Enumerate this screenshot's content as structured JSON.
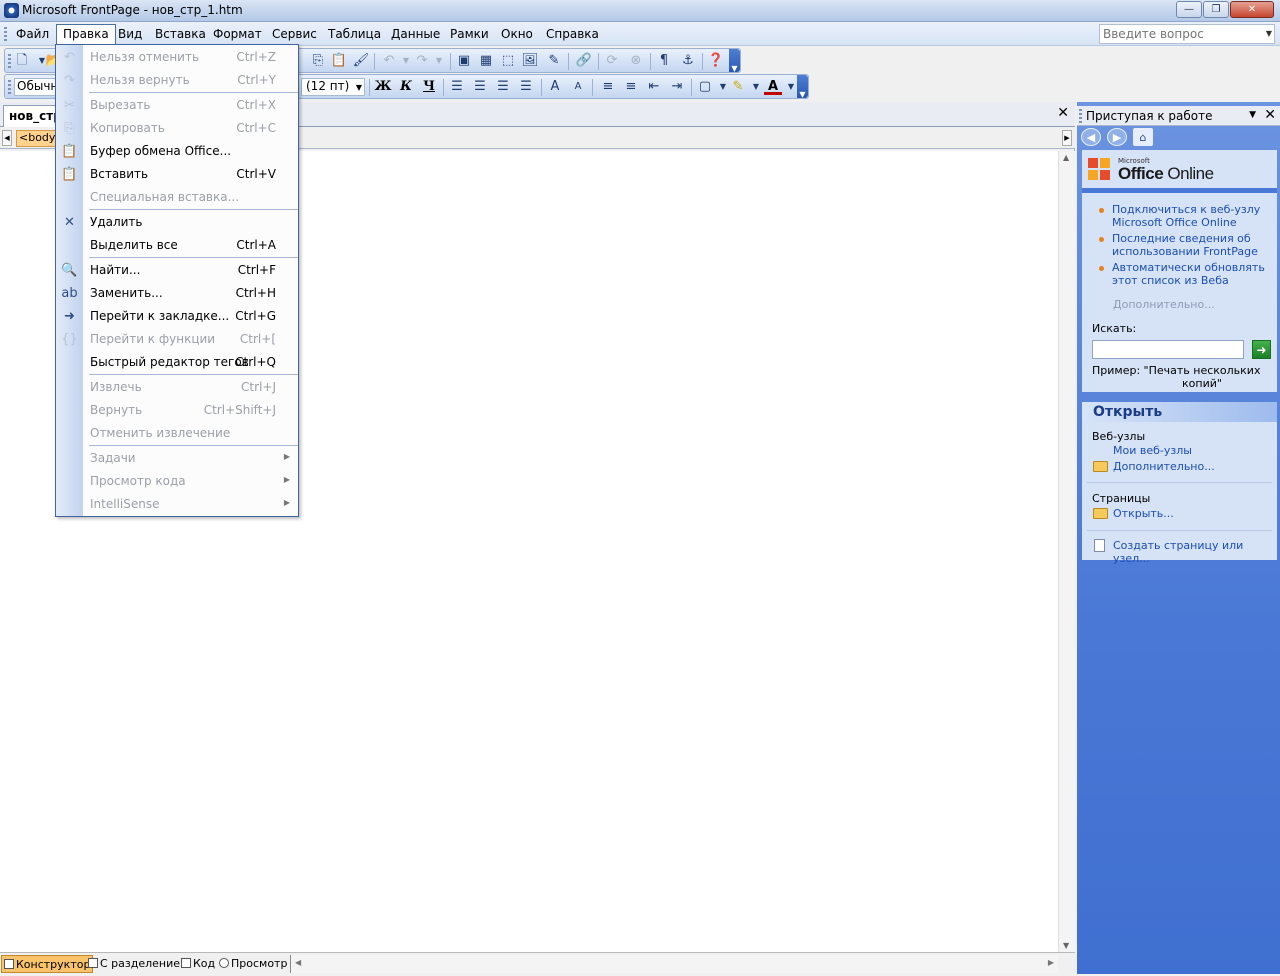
{
  "window": {
    "title": "Microsoft FrontPage - нов_стр_1.htm",
    "minimize_glyph": "—",
    "restore_glyph": "❐",
    "close_glyph": "✕"
  },
  "menubar": {
    "items": [
      "Файл",
      "Правка",
      "Вид",
      "Вставка",
      "Формат",
      "Сервис",
      "Таблица",
      "Данные",
      "Рамки",
      "Окно",
      "Справка"
    ],
    "active_item": "Правка",
    "ask_placeholder": "Введите вопрос"
  },
  "formatting": {
    "style_value": "Обычный",
    "size_value": "(12 пт)",
    "bold": "Ж",
    "italic": "К",
    "underline": "Ч"
  },
  "document": {
    "tab_label": "нов_стр_1.htm",
    "tag_chip": "<body>"
  },
  "view_tabs": [
    "Конструктор",
    "С разделением",
    "Код",
    "Просмотр"
  ],
  "active_view": "Конструктор",
  "edit_menu": {
    "items": [
      {
        "icon": "undo-icon",
        "glyph": "↶",
        "label": "Нельзя отменить",
        "shortcut": "Ctrl+Z",
        "enabled": false
      },
      {
        "icon": "redo-icon",
        "glyph": "↷",
        "label": "Нельзя вернуть",
        "shortcut": "Ctrl+Y",
        "enabled": false
      },
      {
        "icon": "cut-icon",
        "glyph": "✂",
        "label": "Вырезать",
        "shortcut": "Ctrl+X",
        "enabled": false
      },
      {
        "icon": "copy-icon",
        "glyph": "⎘",
        "label": "Копировать",
        "shortcut": "Ctrl+C",
        "enabled": false
      },
      {
        "icon": "office-clipboard-icon",
        "glyph": "📋",
        "label": "Буфер обмена Office...",
        "shortcut": "",
        "enabled": true
      },
      {
        "icon": "paste-icon",
        "glyph": "📋",
        "label": "Вставить",
        "shortcut": "Ctrl+V",
        "enabled": true
      },
      {
        "icon": "",
        "glyph": "",
        "label": "Специальная вставка...",
        "shortcut": "",
        "enabled": false
      },
      {
        "icon": "delete-icon",
        "glyph": "✕",
        "label": "Удалить",
        "shortcut": "",
        "enabled": true
      },
      {
        "icon": "",
        "glyph": "",
        "label": "Выделить все",
        "shortcut": "Ctrl+A",
        "enabled": true
      },
      {
        "icon": "find-icon",
        "glyph": "🔍",
        "label": "Найти...",
        "shortcut": "Ctrl+F",
        "enabled": true
      },
      {
        "icon": "replace-icon",
        "glyph": "ab",
        "label": "Заменить...",
        "shortcut": "Ctrl+H",
        "enabled": true
      },
      {
        "icon": "goto-bookmark-icon",
        "glyph": "➜",
        "label": "Перейти к закладке...",
        "shortcut": "Ctrl+G",
        "enabled": true
      },
      {
        "icon": "goto-function-icon",
        "glyph": "{}",
        "label": "Перейти к функции",
        "shortcut": "Ctrl+[",
        "enabled": false
      },
      {
        "icon": "",
        "glyph": "",
        "label": "Быстрый редактор тегов",
        "shortcut": "Ctrl+Q",
        "enabled": true
      },
      {
        "icon": "",
        "glyph": "",
        "label": "Извлечь",
        "shortcut": "Ctrl+J",
        "enabled": false
      },
      {
        "icon": "",
        "glyph": "",
        "label": "Вернуть",
        "shortcut": "Ctrl+Shift+J",
        "enabled": false
      },
      {
        "icon": "",
        "glyph": "",
        "label": "Отменить извлечение",
        "shortcut": "",
        "enabled": false
      },
      {
        "icon": "",
        "glyph": "",
        "label": "Задачи",
        "shortcut": "",
        "enabled": false,
        "submenu": true
      },
      {
        "icon": "",
        "glyph": "",
        "label": "Просмотр кода",
        "shortcut": "",
        "enabled": false,
        "submenu": true
      },
      {
        "icon": "",
        "glyph": "",
        "label": "IntelliSense",
        "shortcut": "",
        "enabled": false,
        "submenu": true
      }
    ]
  },
  "taskpane": {
    "title": "Приступая к работе",
    "logo": {
      "microsoft": "Microsoft",
      "office": "Office",
      "online": "Online"
    },
    "links": [
      "Подключиться к веб-узлу Microsoft Office Online",
      "Последние сведения об использовании FrontPage",
      "Автоматически обновлять этот список из Веба"
    ],
    "more_link": "Дополнительно...",
    "search_label": "Искать:",
    "example_label": "Пример:",
    "example_text": "\"Печать нескольких копий\"",
    "open_header": "Открыть",
    "websites_label": "Веб-узлы",
    "my_websites": "Мои веб-узлы",
    "websites_more": "Дополнительно...",
    "pages_label": "Страницы",
    "pages_open": "Открыть...",
    "create_link": "Создать страницу или узел..."
  },
  "colors": {
    "accent": "#4a78d6",
    "menu_border": "#3f64a0",
    "active_view": "#f8c36a"
  }
}
